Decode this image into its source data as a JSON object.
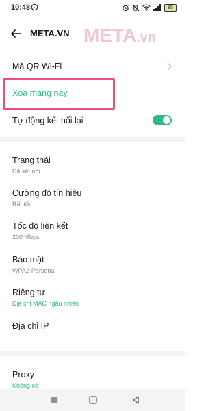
{
  "status_bar": {
    "time": "10:48",
    "battery": "85"
  },
  "header": {
    "title": "META.VN",
    "watermark_main": "META",
    "watermark_suffix": ".vn"
  },
  "rows": {
    "qr": {
      "title": "Mã QR Wi-Fi"
    },
    "forget": {
      "title": "Xóa mạng này"
    },
    "auto": {
      "title": "Tự động kết nối lại",
      "toggle_on": true
    },
    "status": {
      "title": "Trạng thái",
      "value": "Đã kết nối"
    },
    "signal": {
      "title": "Cường độ tín hiệu",
      "value": "Rất tốt"
    },
    "speed": {
      "title": "Tốc độ liên kết",
      "value": "200 Mbps"
    },
    "security": {
      "title": "Bảo mật",
      "value": "WPA2-Personal"
    },
    "privacy": {
      "title": "Riêng tư",
      "value": "Địa chỉ MAC ngẫu nhiên"
    },
    "ip": {
      "title": "Địa chỉ IP"
    },
    "proxy": {
      "title": "Proxy",
      "value": "Không có"
    }
  },
  "colors": {
    "accent": "#2fb98a",
    "highlight": "#ea4f7c",
    "watermark": "#f3c6cf"
  },
  "icons": [
    "back-arrow-icon",
    "chevron-right-icon",
    "wifi-icon",
    "signal-icon",
    "alarm-icon",
    "whatsapp-icon",
    "home-icon",
    "recents-icon",
    "back-triangle-icon"
  ]
}
